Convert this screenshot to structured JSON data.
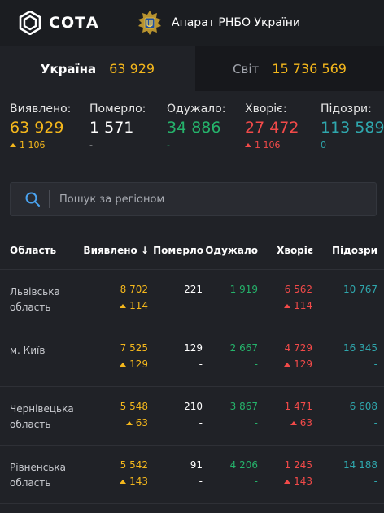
{
  "header": {
    "logo_text": "СОТА",
    "org_name": "Апарат РНБО України"
  },
  "tabs": [
    {
      "label": "Україна",
      "value": "63 929",
      "active": true
    },
    {
      "label": "Світ",
      "value": "15 736 569",
      "active": false
    }
  ],
  "stats": [
    {
      "label": "Виявлено:",
      "value": "63 929",
      "delta": "1 106",
      "color": "#f4b71c",
      "arrow": true
    },
    {
      "label": "Померло:",
      "value": "1 571",
      "delta": "-",
      "color": "#ffffff",
      "arrow": false
    },
    {
      "label": "Одужало:",
      "value": "34 886",
      "delta": "-",
      "color": "#25b36b",
      "arrow": false
    },
    {
      "label": "Хворіє:",
      "value": "27 472",
      "delta": "1 106",
      "color": "#f24a49",
      "arrow": true
    },
    {
      "label": "Підозри:",
      "value": "113 589",
      "delta": "0",
      "color": "#2fa7ad",
      "arrow": false
    }
  ],
  "search": {
    "placeholder": "Пошук за регіоном"
  },
  "table": {
    "columns": [
      "Область",
      "Виявлено",
      "Померло",
      "Одужало",
      "Хворіє",
      "Підозри"
    ],
    "sort_indicator": "↓",
    "rows": [
      {
        "region": "Львівська область",
        "detected": "8 702",
        "detected_delta": "114",
        "deaths": "221",
        "deaths_delta": "-",
        "recovered": "1 919",
        "recovered_delta": "-",
        "sick": "6 562",
        "sick_delta": "114",
        "suspected": "10 767",
        "suspected_delta": "-"
      },
      {
        "region": "м. Київ",
        "detected": "7 525",
        "detected_delta": "129",
        "deaths": "129",
        "deaths_delta": "-",
        "recovered": "2 667",
        "recovered_delta": "-",
        "sick": "4 729",
        "sick_delta": "129",
        "suspected": "16 345",
        "suspected_delta": "-"
      },
      {
        "region": "Чернівецька область",
        "detected": "5 548",
        "detected_delta": "63",
        "deaths": "210",
        "deaths_delta": "-",
        "recovered": "3 867",
        "recovered_delta": "-",
        "sick": "1 471",
        "sick_delta": "63",
        "suspected": "6 608",
        "suspected_delta": "-"
      },
      {
        "region": "Рівненська область",
        "detected": "5 542",
        "detected_delta": "143",
        "deaths": "91",
        "deaths_delta": "-",
        "recovered": "4 206",
        "recovered_delta": "-",
        "sick": "1 245",
        "sick_delta": "143",
        "suspected": "14 188",
        "suspected_delta": "-"
      }
    ]
  },
  "colors": {
    "accent_yellow": "#f4b71c",
    "recovered_green": "#25b36b",
    "sick_red": "#f24a49",
    "suspected_teal": "#2fa7ad",
    "background": "#202227"
  }
}
